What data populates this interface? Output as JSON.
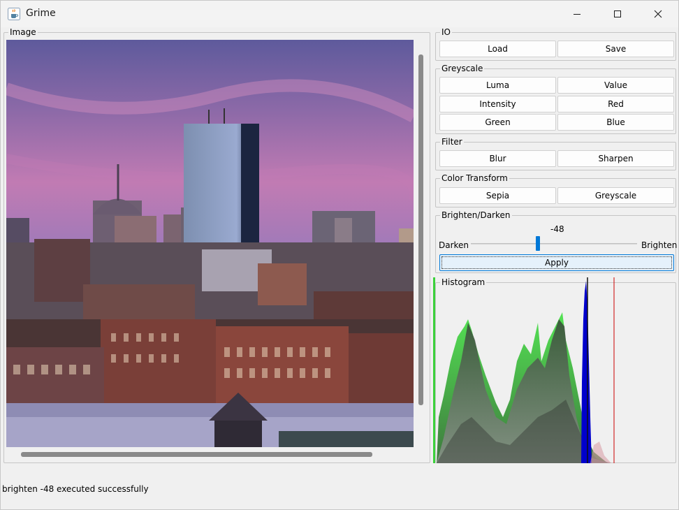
{
  "window": {
    "title": "Grime"
  },
  "icons": {
    "app": "java-cup-icon",
    "minimize": "minimize-icon",
    "maximize": "maximize-icon",
    "close": "close-icon"
  },
  "image_panel": {
    "legend": "Image"
  },
  "io": {
    "legend": "IO",
    "load": "Load",
    "save": "Save"
  },
  "greyscale": {
    "legend": "Greyscale",
    "luma": "Luma",
    "value": "Value",
    "intensity": "Intensity",
    "red": "Red",
    "green": "Green",
    "blue": "Blue"
  },
  "filter": {
    "legend": "Filter",
    "blur": "Blur",
    "sharpen": "Sharpen"
  },
  "color_transform": {
    "legend": "Color Transform",
    "sepia": "Sepia",
    "greyscale": "Greyscale"
  },
  "brighten": {
    "legend": "Brighten/Darken",
    "value": "-48",
    "darken_label": "Darken",
    "brighten_label": "Brighten",
    "apply": "Apply",
    "slider_min": -255,
    "slider_max": 255
  },
  "histogram": {
    "legend": "Histogram"
  },
  "status": {
    "message": "brighten -48 executed successfully"
  },
  "colors": {
    "accent": "#0078d7",
    "histogram_green": "#39e339",
    "histogram_blue": "#0000cc",
    "histogram_red": "#cc0000"
  }
}
